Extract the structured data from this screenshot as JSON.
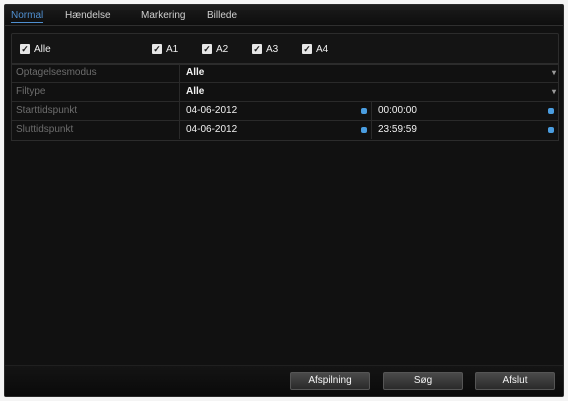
{
  "tabs": [
    {
      "label": "Normal",
      "active": true
    },
    {
      "label": "Hændelse",
      "active": false
    },
    {
      "label": "Markering",
      "active": false
    },
    {
      "label": "Billede",
      "active": false
    }
  ],
  "channels": {
    "all": {
      "label": "Alle",
      "checked": true
    },
    "items": [
      {
        "label": "A1",
        "checked": true
      },
      {
        "label": "A2",
        "checked": true
      },
      {
        "label": "A3",
        "checked": true
      },
      {
        "label": "A4",
        "checked": true
      }
    ]
  },
  "form": {
    "record_mode": {
      "label": "Optagelsesmodus",
      "value": "Alle"
    },
    "file_type": {
      "label": "Filtype",
      "value": "Alle"
    },
    "start_time": {
      "label": "Starttidspunkt",
      "date": "04-06-2012",
      "time": "00:00:00"
    },
    "end_time": {
      "label": "Sluttidspunkt",
      "date": "04-06-2012",
      "time": "23:59:59"
    }
  },
  "buttons": {
    "playback": "Afspilning",
    "search": "Søg",
    "exit": "Afslut"
  },
  "colors": {
    "active_tab": "#4f8fd0",
    "picker_dot": "#4a9de0",
    "background": "#111111"
  },
  "icons": {
    "checkbox": "check-mark",
    "dropdown": "chevron-down",
    "date_picker": "calendar-dot",
    "time_picker": "clock-dot"
  }
}
